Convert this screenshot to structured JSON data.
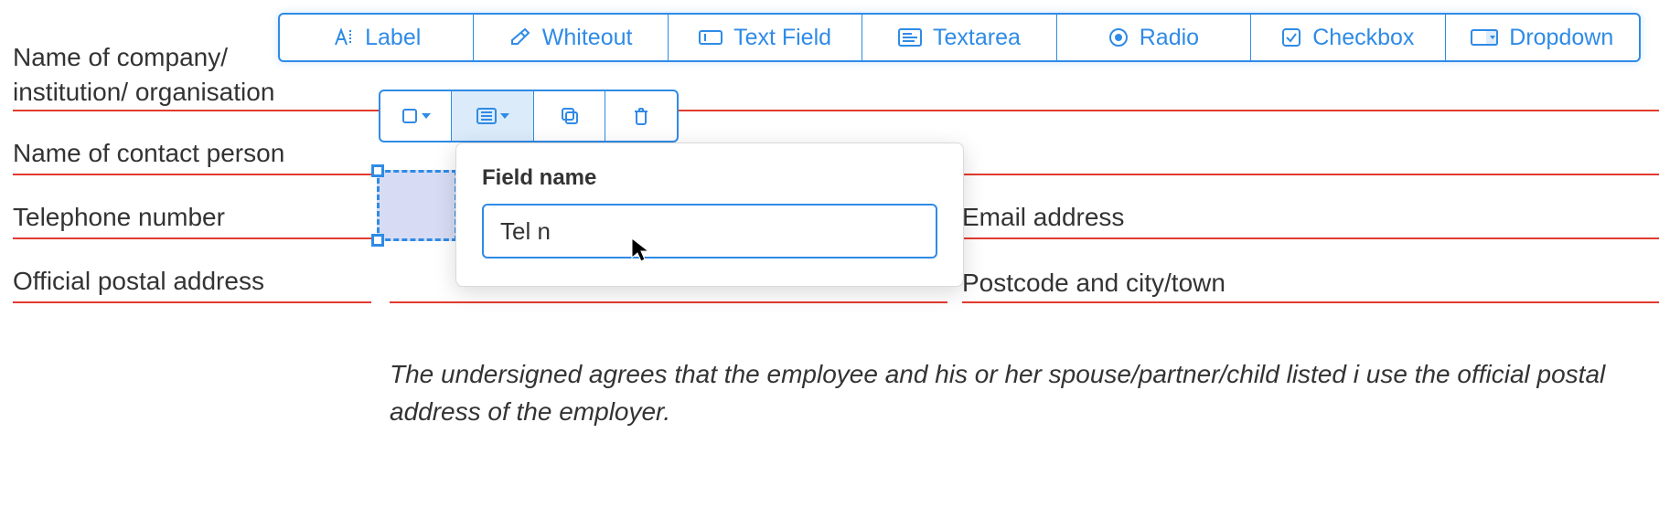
{
  "toolbar": {
    "label": "Label",
    "whiteout": "Whiteout",
    "textfield": "Text Field",
    "textarea": "Textarea",
    "radio": "Radio",
    "checkbox": "Checkbox",
    "dropdown": "Dropdown"
  },
  "form": {
    "company": "Name of company/\ninstitution/ organisation",
    "contact": "Name of contact person",
    "telephone": "Telephone number",
    "postal": "Official postal address",
    "email": "Email address",
    "postcode": "Postcode and city/town"
  },
  "popover": {
    "label": "Field name",
    "value": "Tel n"
  },
  "body_text": "The undersigned agrees that the employee and his or her spouse/partner/child listed i use the official postal address of the employer."
}
